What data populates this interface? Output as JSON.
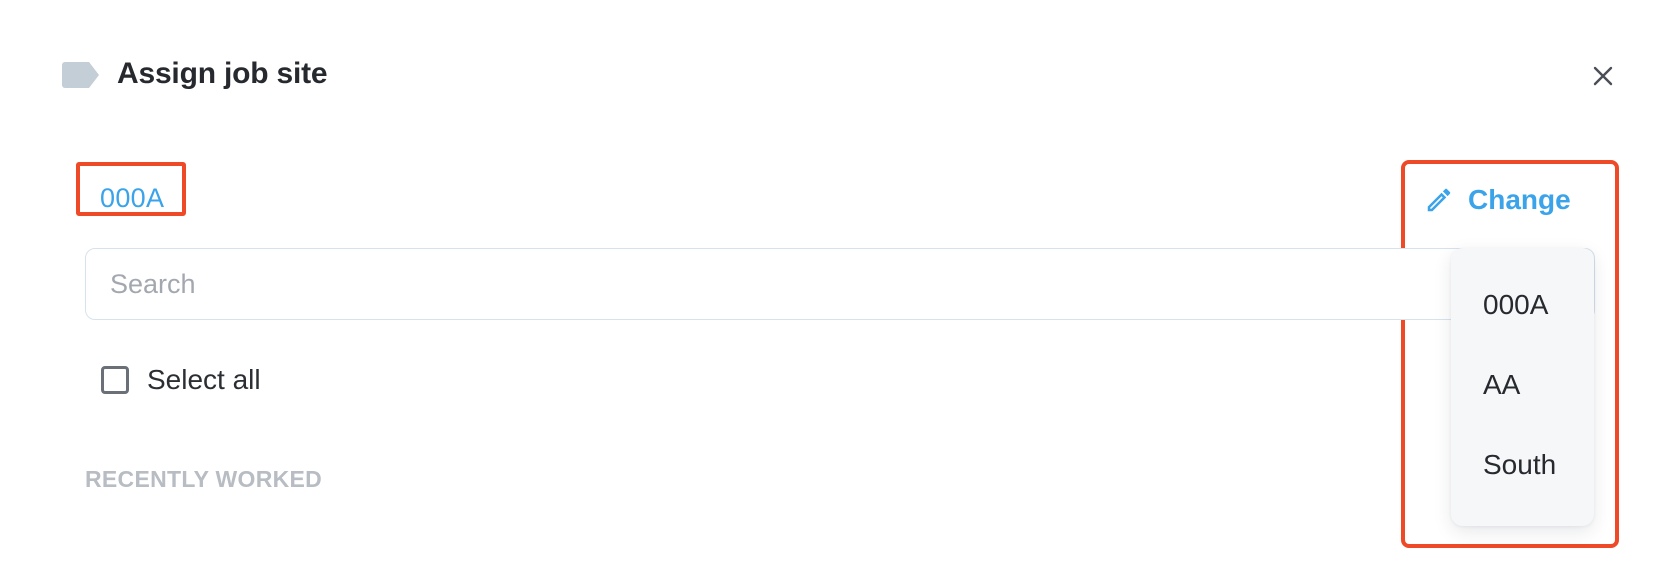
{
  "dialog": {
    "title": "Assign job site",
    "close_icon": "close-icon",
    "tag_icon": "tag-icon"
  },
  "selected_site": "000A",
  "change": {
    "label": "Change",
    "icon": "pencil-icon"
  },
  "search": {
    "placeholder": "Search",
    "value": ""
  },
  "select_all": {
    "label": "Select all",
    "checked": false
  },
  "section": {
    "recently_worked": "RECENTLY WORKED"
  },
  "dropdown": {
    "items": [
      {
        "label": "000A"
      },
      {
        "label": "AA"
      },
      {
        "label": "South"
      }
    ]
  },
  "colors": {
    "accent": "#3aa3ea",
    "highlight": "#ee4a28",
    "muted": "#b8bcc3",
    "tag_icon": "#c3ced7"
  }
}
